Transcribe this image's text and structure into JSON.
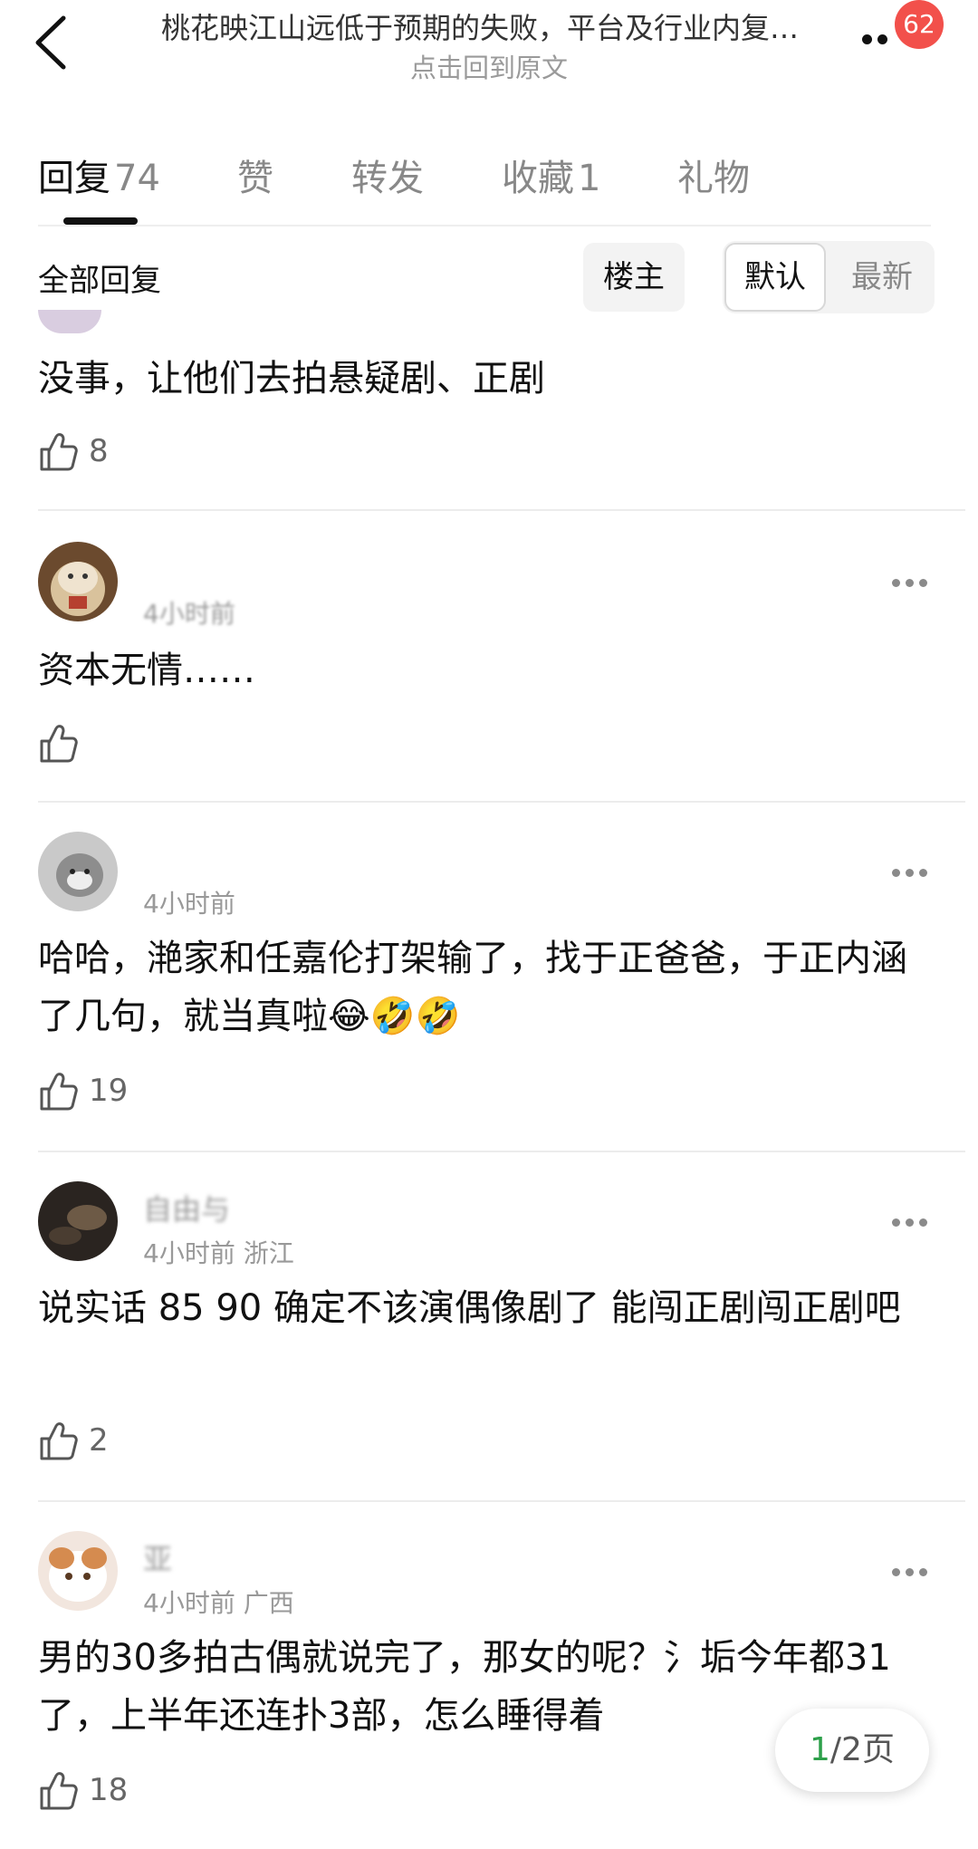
{
  "header": {
    "title": "桃花映江山远低于预期的失败，平台及行业内复…",
    "subtitle": "点击回到原文",
    "badge": "62"
  },
  "tabs": [
    {
      "label": "回复",
      "count": "74"
    },
    {
      "label": "赞",
      "count": ""
    },
    {
      "label": "转发",
      "count": ""
    },
    {
      "label": "收藏",
      "count": "1"
    },
    {
      "label": "礼物",
      "count": ""
    }
  ],
  "filter": {
    "title": "全部回复",
    "owner_label": "楼主",
    "sort_default": "默认",
    "sort_latest": "最新"
  },
  "comments": [
    {
      "username": "",
      "meta": "",
      "text": "没事，让他们去拍悬疑剧、正剧",
      "likes": "8"
    },
    {
      "username": "",
      "meta": "4小时前",
      "text": "资本无情……",
      "likes": ""
    },
    {
      "username": "",
      "meta": "4小时前",
      "text": "哈哈，滟家和任嘉伦打架输了，找于正爸爸，于正内涵了几句，就当真啦😂🤣🤣",
      "likes": "19"
    },
    {
      "username": "自由与",
      "meta": "4小时前 浙江",
      "text": "说实话 85 90 确定不该演偶像剧了 能闯正剧闯正剧吧",
      "likes": "2"
    },
    {
      "username": "亚",
      "meta": "4小时前 广西",
      "text": "男的30多拍古偶就说完了，那女的呢？氵垢今年都31了，上半年还连扑3部，怎么睡得着",
      "likes": "18"
    }
  ],
  "pager": {
    "current": "1",
    "rest": "/2页"
  },
  "colors": {
    "badge": "#f2504b",
    "pager_current": "#2ea04b"
  }
}
